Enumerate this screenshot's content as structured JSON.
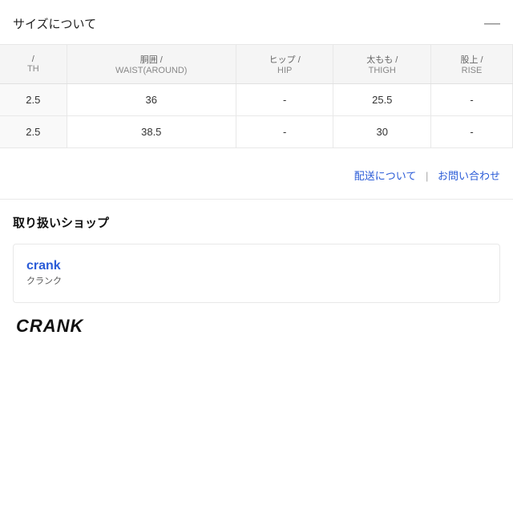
{
  "sectionHeader": {
    "title": "サイズについて",
    "collapseIcon": "—"
  },
  "table": {
    "headers": [
      {
        "jp": "/",
        "en": "TH"
      },
      {
        "jp": "胴囲 /",
        "en": "WAIST(AROUND)"
      },
      {
        "jp": "ヒップ /",
        "en": "HIP"
      },
      {
        "jp": "太もも /",
        "en": "THIGH"
      },
      {
        "jp": "股上 /",
        "en": "RISE"
      }
    ],
    "rows": [
      {
        "size": "2.5",
        "waist": "36",
        "hip": "-",
        "thigh": "25.5",
        "rise": "-"
      },
      {
        "size": "2.5",
        "waist": "38.5",
        "hip": "-",
        "thigh": "30",
        "rise": "-"
      }
    ]
  },
  "delivery": {
    "link1": "配送について",
    "divider": "|",
    "link2": "お問い合わせ"
  },
  "shopsSection": {
    "title": "取り扱いショップ",
    "shop": {
      "nameEn": "crank",
      "nameJp": "クランク",
      "logoText": "CRANK"
    }
  }
}
